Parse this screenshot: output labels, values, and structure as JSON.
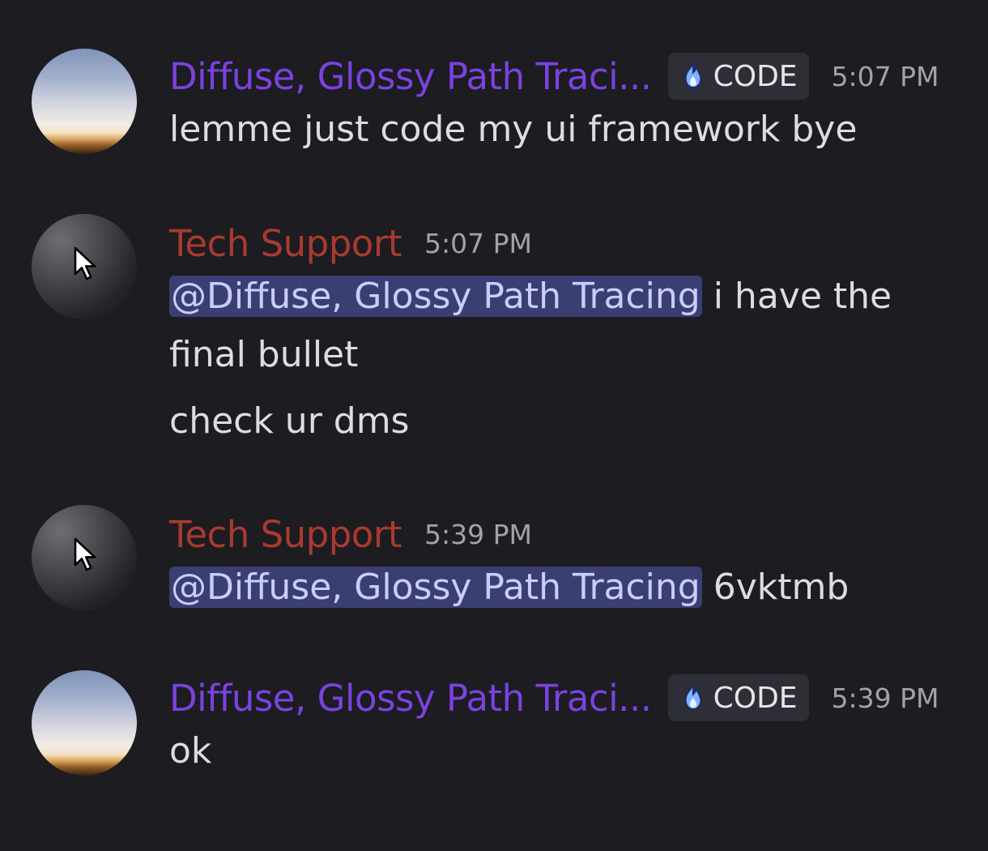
{
  "messages": [
    {
      "author": "Diffuse, Glossy Path Traci...",
      "tag": "CODE",
      "time": "5:07 PM",
      "text": "lemme just code my ui framework bye"
    },
    {
      "author": "Tech Support",
      "time": "5:07 PM",
      "mention": "@Diffuse, Glossy Path Tracing",
      "text": " i have the",
      "text_line2": "final bullet",
      "text2": "check ur dms"
    },
    {
      "author": "Tech Support",
      "time": "5:39 PM",
      "mention": "@Diffuse, Glossy Path Tracing",
      "text": " 6vktmb"
    },
    {
      "author": "Diffuse, Glossy Path Traci...",
      "tag": "CODE",
      "time": "5:39 PM",
      "text": "ok"
    }
  ],
  "colors": {
    "background": "#1c1c21",
    "author_purple": "#7b42e0",
    "author_red": "#a83a30",
    "mention_bg": "#3b3e72",
    "mention_text": "#c9cdfb",
    "timestamp": "#a2a3aa",
    "message_text": "#dcdde1"
  },
  "icons": {
    "tag_icon": "blue-flame-icon",
    "avatar_cursor": "cursor-icon"
  }
}
